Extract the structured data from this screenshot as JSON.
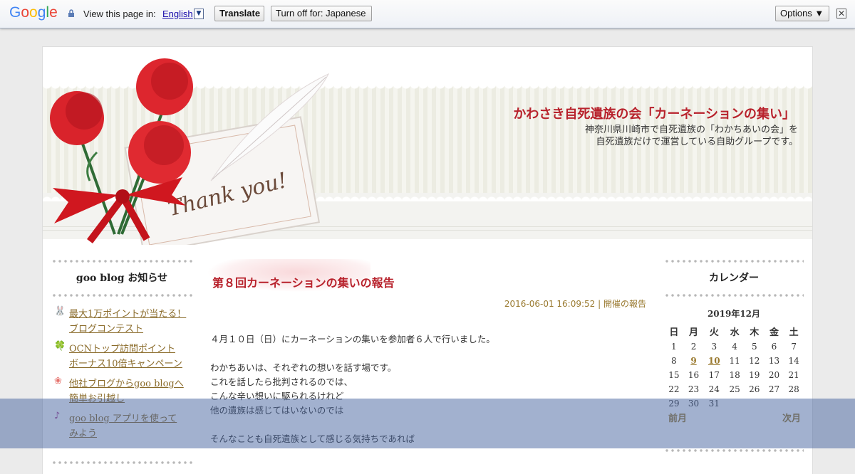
{
  "translate_bar": {
    "logo": [
      "G",
      "o",
      "o",
      "g",
      "l",
      "e"
    ],
    "view_text": "View this page in:",
    "language": "English",
    "translate_label": "Translate",
    "turn_off_label": "Turn off for: Japanese",
    "options_label": "Options ▼",
    "close_glyph": "✕"
  },
  "header": {
    "title": "かわさき自死遺族の会「カーネーションの集い」",
    "description_line1": "神奈川県川崎市で自死遺族の「わかちあいの会」を",
    "description_line2": "自死遺族だけで運営している自助グループです。",
    "card_text": "Thank you!"
  },
  "left": {
    "heading": "goo blog お知らせ",
    "items": [
      {
        "icon": "rabbit-icon",
        "glyph": "🐰",
        "line1": "最大1万ポイントが当たる！",
        "line2": "ブログコンテスト"
      },
      {
        "icon": "clover-icon",
        "glyph": "🍀",
        "line1": "OCNトップ訪問ポイント",
        "line2": "ボーナス10倍キャンペーン"
      },
      {
        "icon": "flower-icon",
        "glyph": "❀",
        "line1": "他社ブログからgoo blogへ",
        "line2": "簡単お引越し"
      },
      {
        "icon": "music-note-icon",
        "glyph": "♪",
        "line1": "goo blog アプリを使って",
        "line2": "みよう"
      }
    ]
  },
  "post": {
    "title": "第８回カーネーションの集いの報告",
    "date": "2016-06-01 16:09:52",
    "separator": " | ",
    "category": "開催の報告",
    "paragraphs": [
      [
        "４月１０日（日）にカーネーションの集いを参加者６人で行いました。"
      ],
      [
        "わかちあいは、それぞれの想いを話す場です。",
        "これを話したら批判されるのでは、",
        "こんな辛い想いに駆られるけれど",
        "他の遺族は感じてはいないのでは"
      ],
      [
        "そんなことも自死遺族として感じる気持ちであれば"
      ]
    ]
  },
  "calendar": {
    "heading": "カレンダー",
    "month": "2019年12月",
    "weekdays": [
      "日",
      "月",
      "火",
      "水",
      "木",
      "金",
      "土"
    ],
    "weeks": [
      [
        "1",
        "2",
        "3",
        "4",
        "5",
        "6",
        "7"
      ],
      [
        "8",
        "9",
        "10",
        "11",
        "12",
        "13",
        "14"
      ],
      [
        "15",
        "16",
        "17",
        "18",
        "19",
        "20",
        "21"
      ],
      [
        "22",
        "23",
        "24",
        "25",
        "26",
        "27",
        "28"
      ],
      [
        "29",
        "30",
        "31",
        "",
        "",
        "",
        ""
      ]
    ],
    "linked_days": [
      "9",
      "10"
    ],
    "prev": "前月",
    "next": "次月"
  },
  "colors": {
    "title_red": "#b8222c",
    "link_gold": "#9a7a30",
    "overlay": "#4664a0"
  }
}
